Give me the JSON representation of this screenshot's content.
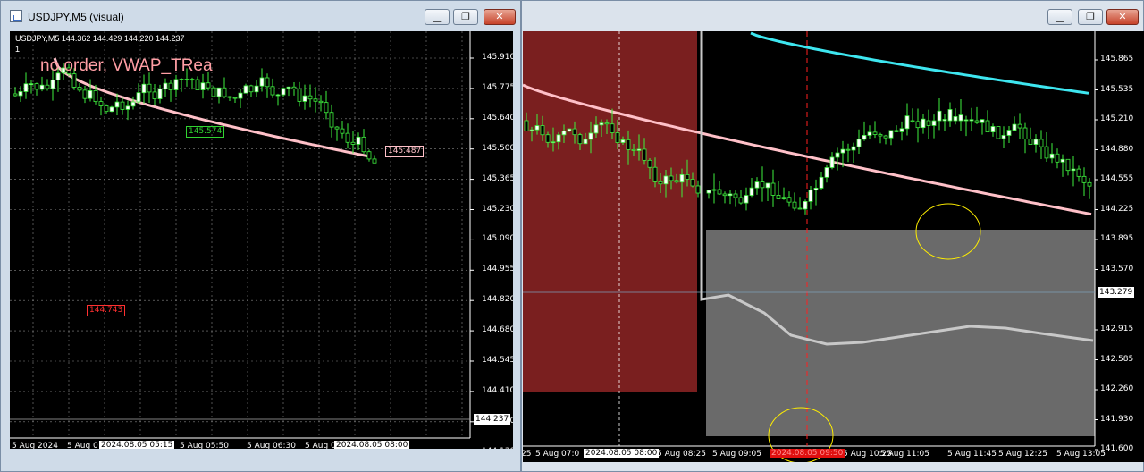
{
  "left_window": {
    "title": "USDJPY,M5 (visual)",
    "controls": {
      "minimize": "▁",
      "maximize": "❐",
      "close": "✕"
    },
    "ohlc_line": "USDJPY,M5  144.362 144.429 144.220 144.237",
    "subline": "1",
    "overlay_text": "no order, VWAP_TRea",
    "price_axis": [
      "145.910",
      "145.775",
      "145.640",
      "145.500",
      "145.365",
      "145.230",
      "145.090",
      "144.955",
      "144.820",
      "144.680",
      "144.545",
      "144.410",
      "144.270",
      "144.130"
    ],
    "current_price": "144.237",
    "time_axis": [
      "5 Aug 2024",
      "5 Aug 0",
      "5 Aug 05:50",
      "5 Aug 06:30",
      "5 Aug 07:"
    ],
    "time_highlights": [
      "2024.08.05 05:15",
      "2024.08.05 08:00"
    ],
    "markers": {
      "high_tag": "145.574",
      "low_tag": "144.743",
      "vwap_tag": "145.487"
    }
  },
  "right_window": {
    "title": "",
    "controls": {
      "minimize": "▁",
      "maximize": "❐",
      "close": "✕"
    },
    "price_axis": [
      "145.865",
      "145.535",
      "145.210",
      "144.880",
      "144.555",
      "144.225",
      "143.895",
      "143.570",
      "142.915",
      "142.585",
      "142.260",
      "141.930",
      "141.600"
    ],
    "current_price": "143.279",
    "time_axis": [
      "25",
      "5 Aug 07:0",
      "5 Aug 08:25",
      "5 Aug 09:05",
      "5 Aug 10:25",
      "5 Aug 11:05",
      "5 Aug 11:45",
      "5 Aug 12:25",
      "5 Aug 13:05"
    ],
    "time_highlights": [
      "2024.08.05 08:00"
    ],
    "time_highlight_red": "2024.08.05 09:50",
    "colors": {
      "box_red": "#7a1f1f",
      "box_gray": "#6a6a6a",
      "vwap_pink": "#ffc0c8",
      "vwap_cyan": "#3ee6f0",
      "vwap_gray": "#c8c8c8",
      "circle": "#ffee00"
    }
  },
  "colors": {
    "bull": "#ffffff",
    "wick": "#3ef03e",
    "up_tag": "#31d331",
    "down_tag": "#ff3030"
  }
}
